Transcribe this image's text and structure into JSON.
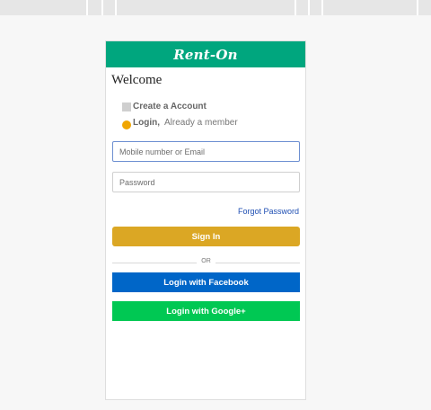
{
  "brand": {
    "title": "Rent-On",
    "color": "#00a67e"
  },
  "welcome": "Welcome",
  "options": {
    "create": {
      "label": "Create a Account"
    },
    "login": {
      "label": "Login,",
      "sublabel": "Already a member"
    }
  },
  "form": {
    "identifier": {
      "placeholder": "Mobile number or Email",
      "value": ""
    },
    "password": {
      "placeholder": "Password",
      "value": ""
    },
    "forgot_label": "Forgot Password"
  },
  "buttons": {
    "signin": "Sign In",
    "or_label": "OR",
    "facebook": "Login with Facebook",
    "google": "Login with Google+"
  },
  "colors": {
    "signin": "#dba724",
    "facebook": "#0066c8",
    "google": "#00c853",
    "radio": "#f0a500"
  }
}
